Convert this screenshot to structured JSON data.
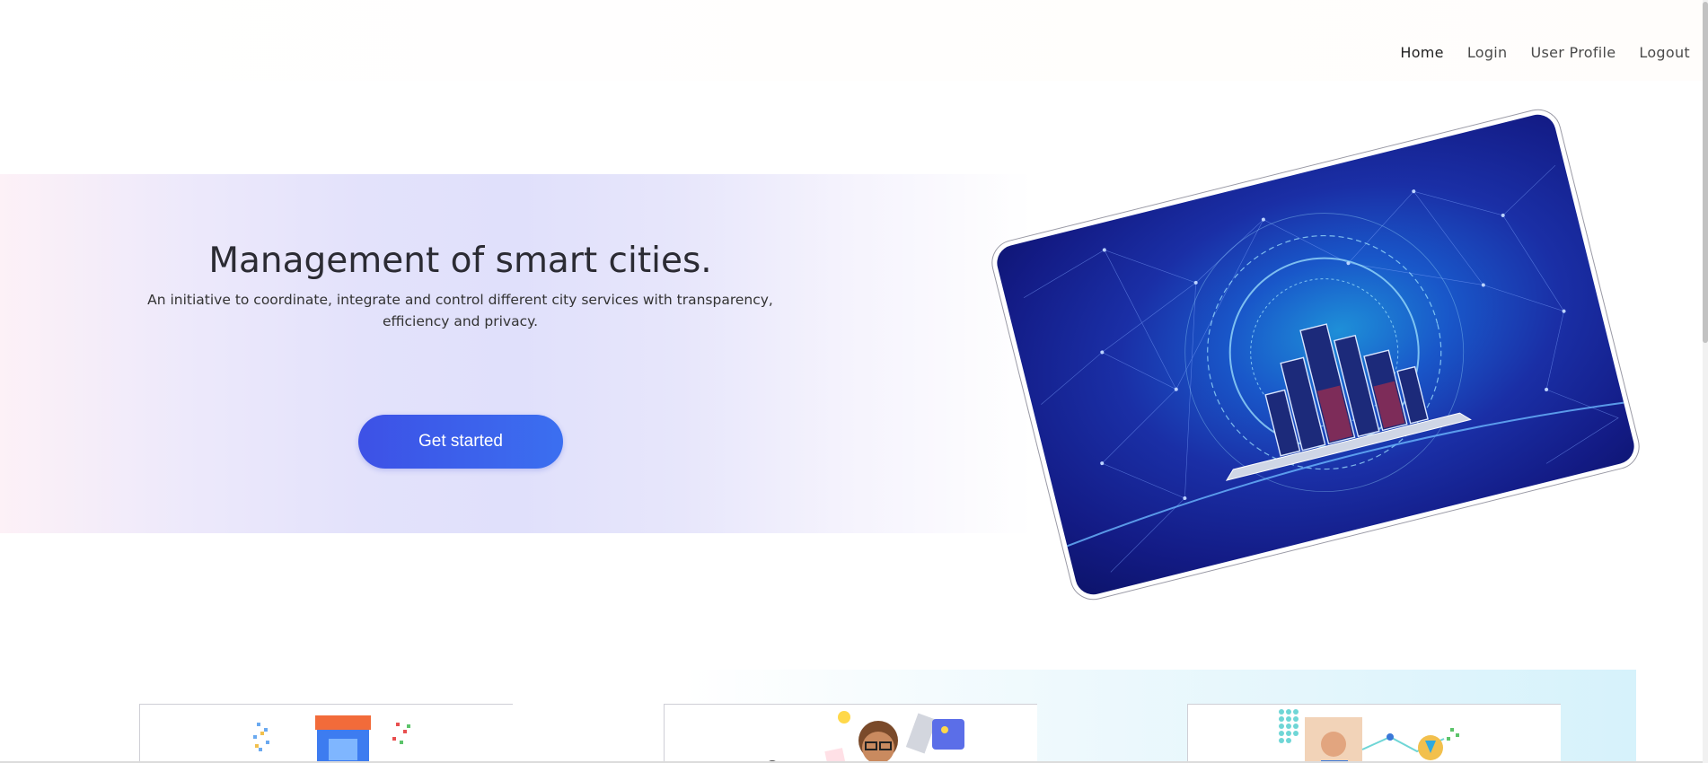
{
  "nav": {
    "items": [
      {
        "label": "Home"
      },
      {
        "label": "Login"
      },
      {
        "label": "User Profile"
      },
      {
        "label": "Logout"
      }
    ]
  },
  "hero": {
    "title": "Management of smart cities.",
    "subtitle": "An initiative to coordinate, integrate and control different city services with transparency, efficiency and privacy.",
    "cta_label": "Get started",
    "image_icon": "smart-city-laptop-illustration"
  },
  "features": {
    "cards": [
      {
        "icon": "marketplace-illustration"
      },
      {
        "icon": "user-avatar-illustration"
      },
      {
        "icon": "video-call-illustration"
      }
    ]
  },
  "colors": {
    "accent": "#3d51e6",
    "accent_end": "#3b6ff0",
    "hero_band": "#e0e0fb",
    "lower_band": "#d6f2fb"
  }
}
